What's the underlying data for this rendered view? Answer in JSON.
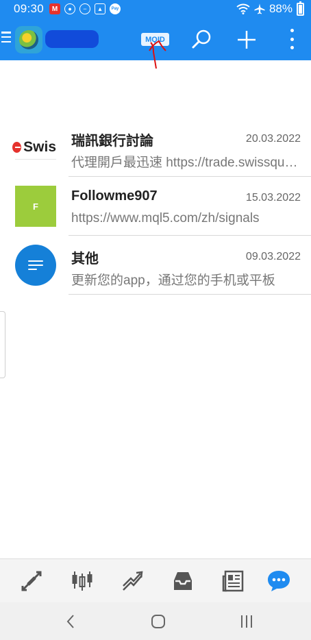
{
  "status_bar": {
    "time": "09:30",
    "battery": "88%",
    "battery_level": 0.88,
    "left_icons": [
      "office-app-icon",
      "account-circle-icon",
      "do-not-disturb-icon",
      "gallery-icon",
      "samsung-pay-icon"
    ],
    "right_icons": [
      "wifi-icon",
      "airplane-icon",
      "battery-icon"
    ],
    "pay_label": "Pay"
  },
  "app_bar": {
    "mqid_label": "MQID",
    "icons": [
      "menu-icon",
      "app-logo",
      "search-icon",
      "add-icon",
      "more-vert-icon"
    ],
    "color": "#1f8bf0"
  },
  "chats": [
    {
      "avatar_text": "Swis",
      "title": "瑞訊銀行討論",
      "date": "20.03.2022",
      "preview": "代理開戶最迅速  https://trade.swissquote.com"
    },
    {
      "avatar_text": "F",
      "title": "Followme907",
      "date": "15.03.2022",
      "preview": "https://www.mql5.com/zh/signals"
    },
    {
      "avatar_text": "",
      "title": "其他",
      "date": "09.03.2022",
      "preview": "更新您的app，通过您的手机或平板"
    }
  ],
  "bottom_nav": {
    "items": [
      "quotes-icon",
      "chart-icon",
      "trade-icon",
      "history-icon",
      "news-icon",
      "messages-icon"
    ],
    "active": "messages-icon",
    "active_color": "#1f8bf0"
  },
  "system_nav": {
    "buttons": [
      "back-icon",
      "home-icon",
      "recents-icon"
    ]
  }
}
